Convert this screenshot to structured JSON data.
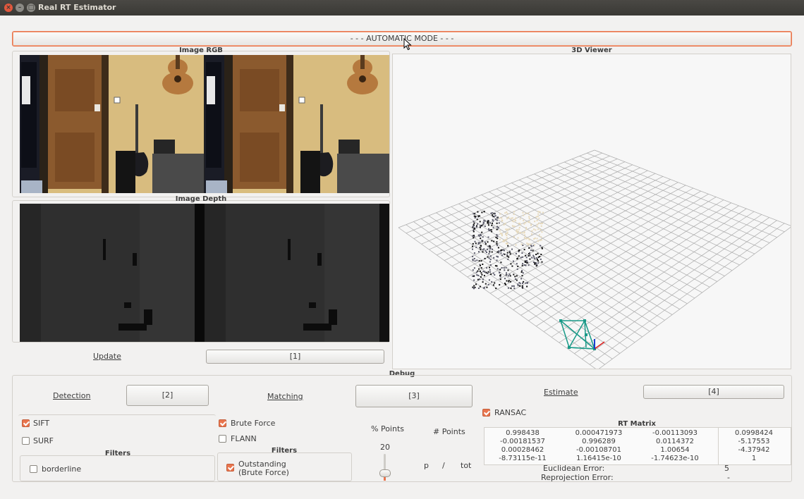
{
  "window": {
    "title": "Real RT Estimator"
  },
  "mode_button": "- - - AUTOMATIC MODE - - -",
  "image_rgb": {
    "title": "Image RGB"
  },
  "image_depth": {
    "title": "Image Depth"
  },
  "viewer": {
    "title": "3D Viewer"
  },
  "update": {
    "link": "Update",
    "button": "[1]"
  },
  "debug": {
    "title": "Debug",
    "detection": {
      "link": "Detection",
      "button": "[2]",
      "sift": {
        "label": "SIFT",
        "checked": true
      },
      "surf": {
        "label": "SURF",
        "checked": false
      },
      "filters_title": "Filters",
      "borderline": {
        "label": "borderline",
        "checked": false
      }
    },
    "matching": {
      "link": "Matching",
      "button": "[3]",
      "brute_force": {
        "label": "Brute Force",
        "checked": true
      },
      "flann": {
        "label": "FLANN",
        "checked": false
      },
      "filters_title": "Filters",
      "outstanding": {
        "label1": "Outstanding",
        "label2": "(Brute Force)",
        "checked": true
      },
      "percent_points_label": "% Points",
      "num_points_label": "# Points",
      "slider_value": "20",
      "p": "p",
      "sep": "/",
      "tot": "tot"
    },
    "estimate": {
      "link": "Estimate",
      "button": "[4]",
      "ransac": {
        "label": "RANSAC",
        "checked": true
      },
      "rt_title": "RT Matrix",
      "rows": [
        [
          "0.998438",
          "0.000471973",
          "-0.00113093",
          "0.0998424"
        ],
        [
          "-0.00181537",
          "0.996289",
          "0.0114372",
          "-5.17553"
        ],
        [
          "0.00028462",
          "-0.00108701",
          "1.00654",
          "-4.37942"
        ],
        [
          "-8.73115e-11",
          "1.16415e-10",
          "-1.74623e-10",
          "1"
        ]
      ],
      "euclidean_label": "Euclidean Error:",
      "euclidean_value": "5",
      "reprojection_label": "Reprojection Error:",
      "reprojection_value": "-"
    }
  }
}
